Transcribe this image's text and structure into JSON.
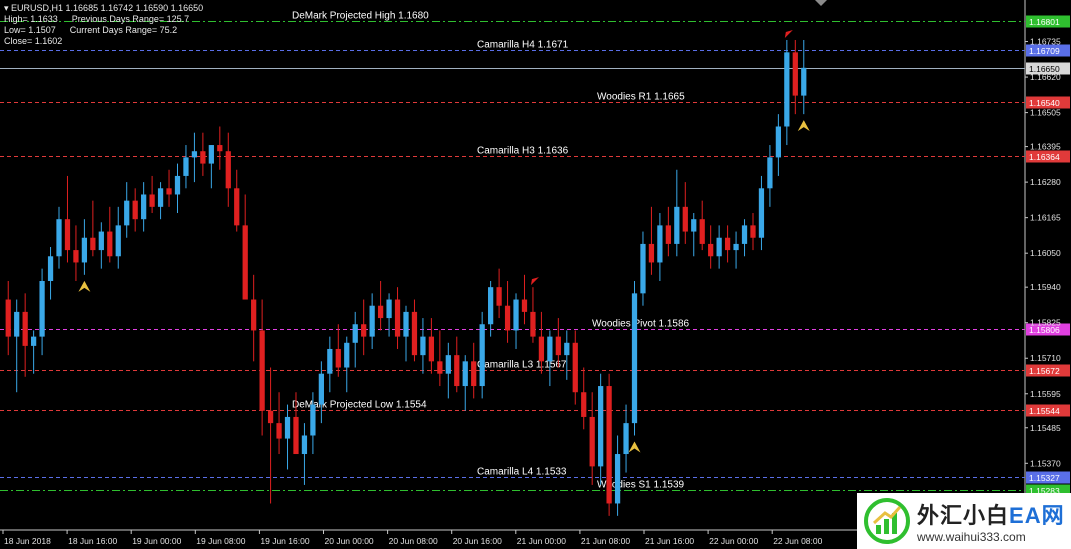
{
  "header": {
    "symbol_line": "EURUSD,H1  1.16685 1.16742 1.16590 1.16650",
    "high": "High= 1.1633",
    "low": "Low= 1.1507",
    "close": "Close= 1.1602",
    "prev_range": "Previous Days Range= 125.7",
    "curr_range": "Current Days Range= 75.2"
  },
  "colors": {
    "bull": "#3aa8e8",
    "bear": "#e02020",
    "green_level": "#2fbf2f",
    "blue_level": "#5a6fe8",
    "red_level": "#e03a3a",
    "magenta_level": "#e040e0",
    "current_price_line": "#a0b0c0",
    "arrow": "#e8c040"
  },
  "levels": [
    {
      "label": "DeMark Projected High 1.1680",
      "price": 1.16801,
      "tag": "1.16801",
      "color": "#2fbf2f",
      "style": "dashdot"
    },
    {
      "label": "Camarilla H4 1.1671",
      "price": 1.16709,
      "tag": "1.16709",
      "color": "#5a6fe8",
      "style": "dashed"
    },
    {
      "label": "",
      "price": 1.1665,
      "tag": "1.16650",
      "color": "#a0b0c0",
      "style": "solid",
      "current": true
    },
    {
      "label": "Woodies R1 1.1665",
      "price": 1.1654,
      "tag": "1.16540",
      "color": "#e03a3a",
      "style": "dashed"
    },
    {
      "label": "Camarilla H3 1.1636",
      "price": 1.16364,
      "tag": "1.16364",
      "color": "#e03a3a",
      "style": "dashed"
    },
    {
      "label": "Woodies Pivot 1.1586",
      "price": 1.15806,
      "tag": "1.15806",
      "color": "#e040e0",
      "style": "dashed"
    },
    {
      "label": "Camarilla L3 1.1567",
      "price": 1.15672,
      "tag": "1.15672",
      "color": "#e03a3a",
      "style": "dashed"
    },
    {
      "label": "DeMark Projected Low 1.1554",
      "price": 1.15544,
      "tag": "1.15544",
      "color": "#e03a3a",
      "style": "dashed"
    },
    {
      "label": "Camarilla L4 1.1533",
      "price": 1.15327,
      "tag": "1.15327",
      "color": "#5a6fe8",
      "style": "dashed"
    },
    {
      "label": "Woodies S1 1.1539",
      "price": 1.15283,
      "tag": "1.15283",
      "color": "#2fbf2f",
      "style": "dashdot"
    }
  ],
  "price_ticks": [
    "1.16735",
    "1.16620",
    "1.16505",
    "1.16395",
    "1.16280",
    "1.16165",
    "1.16050",
    "1.15940",
    "1.15825",
    "1.15710",
    "1.15595",
    "1.15485",
    "1.15370",
    "1.15255"
  ],
  "price_tick_values": [
    1.16735,
    1.1662,
    1.16505,
    1.16395,
    1.1628,
    1.16165,
    1.1605,
    1.1594,
    1.15825,
    1.1571,
    1.15595,
    1.15485,
    1.1537,
    1.15255
  ],
  "time_ticks": [
    "18 Jun 2018",
    "18 Jun 16:00",
    "19 Jun 00:00",
    "19 Jun 08:00",
    "19 Jun 16:00",
    "20 Jun 00:00",
    "20 Jun 08:00",
    "20 Jun 16:00",
    "21 Jun 00:00",
    "21 Jun 08:00",
    "21 Jun 16:00",
    "22 Jun 00:00",
    "22 Jun 08:00"
  ],
  "watermark": {
    "brand": "外汇小白",
    "ea": "EA网",
    "url": "www.waihui333.com"
  },
  "chart_data": {
    "type": "candlestick",
    "symbol": "EURUSD",
    "timeframe": "H1",
    "ylim": [
      1.1518,
      1.1685
    ],
    "candles": [
      [
        1.159,
        1.1596,
        1.1572,
        1.1578
      ],
      [
        1.1578,
        1.159,
        1.156,
        1.1586
      ],
      [
        1.1586,
        1.1592,
        1.1565,
        1.1575
      ],
      [
        1.1575,
        1.158,
        1.1566,
        1.1578
      ],
      [
        1.1578,
        1.16,
        1.1572,
        1.1596
      ],
      [
        1.1596,
        1.1607,
        1.159,
        1.1604
      ],
      [
        1.1604,
        1.162,
        1.16,
        1.1616
      ],
      [
        1.1616,
        1.163,
        1.1602,
        1.1606
      ],
      [
        1.1606,
        1.1614,
        1.1596,
        1.1602
      ],
      [
        1.1602,
        1.1616,
        1.1598,
        1.161
      ],
      [
        1.161,
        1.1622,
        1.1604,
        1.1606
      ],
      [
        1.1606,
        1.1615,
        1.16,
        1.1612
      ],
      [
        1.1612,
        1.162,
        1.1602,
        1.1604
      ],
      [
        1.1604,
        1.162,
        1.16,
        1.1614
      ],
      [
        1.1614,
        1.1628,
        1.161,
        1.1622
      ],
      [
        1.1622,
        1.1626,
        1.1612,
        1.1616
      ],
      [
        1.1616,
        1.1628,
        1.1612,
        1.1624
      ],
      [
        1.1624,
        1.163,
        1.1618,
        1.162
      ],
      [
        1.162,
        1.1628,
        1.1616,
        1.1626
      ],
      [
        1.1626,
        1.1632,
        1.162,
        1.1624
      ],
      [
        1.1624,
        1.1634,
        1.1618,
        1.163
      ],
      [
        1.163,
        1.164,
        1.1626,
        1.1636
      ],
      [
        1.1636,
        1.1644,
        1.1628,
        1.1638
      ],
      [
        1.1638,
        1.1644,
        1.163,
        1.1634
      ],
      [
        1.1634,
        1.164,
        1.1626,
        1.164
      ],
      [
        1.164,
        1.1646,
        1.1632,
        1.1638
      ],
      [
        1.1638,
        1.1644,
        1.162,
        1.1626
      ],
      [
        1.1626,
        1.1632,
        1.1612,
        1.1614
      ],
      [
        1.1614,
        1.1624,
        1.1594,
        1.159
      ],
      [
        1.159,
        1.1598,
        1.157,
        1.158
      ],
      [
        1.158,
        1.159,
        1.1546,
        1.1554
      ],
      [
        1.1554,
        1.1568,
        1.1524,
        1.155
      ],
      [
        1.155,
        1.156,
        1.154,
        1.1545
      ],
      [
        1.1545,
        1.1556,
        1.1535,
        1.1552
      ],
      [
        1.1552,
        1.156,
        1.154,
        1.154
      ],
      [
        1.154,
        1.155,
        1.153,
        1.1546
      ],
      [
        1.1546,
        1.156,
        1.154,
        1.1556
      ],
      [
        1.1556,
        1.157,
        1.155,
        1.1566
      ],
      [
        1.1566,
        1.1578,
        1.156,
        1.1574
      ],
      [
        1.1574,
        1.1582,
        1.1565,
        1.1568
      ],
      [
        1.1568,
        1.1578,
        1.156,
        1.1576
      ],
      [
        1.1576,
        1.1586,
        1.1568,
        1.1582
      ],
      [
        1.1582,
        1.159,
        1.1572,
        1.1578
      ],
      [
        1.1578,
        1.1592,
        1.1574,
        1.1588
      ],
      [
        1.1588,
        1.1596,
        1.158,
        1.1584
      ],
      [
        1.1584,
        1.1592,
        1.1578,
        1.159
      ],
      [
        1.159,
        1.1594,
        1.1574,
        1.1578
      ],
      [
        1.1578,
        1.1588,
        1.157,
        1.1586
      ],
      [
        1.1586,
        1.159,
        1.157,
        1.1572
      ],
      [
        1.1572,
        1.1584,
        1.1566,
        1.1578
      ],
      [
        1.1578,
        1.1584,
        1.1566,
        1.157
      ],
      [
        1.157,
        1.158,
        1.1562,
        1.1566
      ],
      [
        1.1566,
        1.1576,
        1.1558,
        1.1572
      ],
      [
        1.1572,
        1.1578,
        1.156,
        1.1562
      ],
      [
        1.1562,
        1.1572,
        1.1554,
        1.157
      ],
      [
        1.157,
        1.1576,
        1.1558,
        1.1562
      ],
      [
        1.1562,
        1.1586,
        1.1558,
        1.1582
      ],
      [
        1.1582,
        1.1596,
        1.1578,
        1.1594
      ],
      [
        1.1594,
        1.16,
        1.1584,
        1.1588
      ],
      [
        1.1588,
        1.1596,
        1.1576,
        1.158
      ],
      [
        1.158,
        1.1592,
        1.1574,
        1.159
      ],
      [
        1.159,
        1.1598,
        1.1582,
        1.1586
      ],
      [
        1.1586,
        1.1594,
        1.1576,
        1.1578
      ],
      [
        1.1578,
        1.1586,
        1.1566,
        1.157
      ],
      [
        1.157,
        1.158,
        1.1562,
        1.1578
      ],
      [
        1.1578,
        1.1584,
        1.1568,
        1.1572
      ],
      [
        1.1572,
        1.158,
        1.1564,
        1.1576
      ],
      [
        1.1576,
        1.158,
        1.1556,
        1.156
      ],
      [
        1.156,
        1.1568,
        1.1548,
        1.1552
      ],
      [
        1.1552,
        1.156,
        1.153,
        1.1536
      ],
      [
        1.1536,
        1.1566,
        1.153,
        1.1562
      ],
      [
        1.1562,
        1.1566,
        1.152,
        1.1524
      ],
      [
        1.1524,
        1.1546,
        1.152,
        1.154
      ],
      [
        1.154,
        1.1556,
        1.1534,
        1.155
      ],
      [
        1.155,
        1.1596,
        1.1546,
        1.1592
      ],
      [
        1.1592,
        1.1612,
        1.1588,
        1.1608
      ],
      [
        1.1608,
        1.162,
        1.1598,
        1.1602
      ],
      [
        1.1602,
        1.1618,
        1.1596,
        1.1614
      ],
      [
        1.1614,
        1.162,
        1.1604,
        1.1608
      ],
      [
        1.1608,
        1.1632,
        1.1604,
        1.162
      ],
      [
        1.162,
        1.1628,
        1.1608,
        1.1612
      ],
      [
        1.1612,
        1.1618,
        1.1604,
        1.1616
      ],
      [
        1.1616,
        1.1622,
        1.1606,
        1.1608
      ],
      [
        1.1608,
        1.1614,
        1.16,
        1.1604
      ],
      [
        1.1604,
        1.1614,
        1.16,
        1.161
      ],
      [
        1.161,
        1.1614,
        1.1602,
        1.1606
      ],
      [
        1.1606,
        1.1612,
        1.16,
        1.1608
      ],
      [
        1.1608,
        1.1616,
        1.1604,
        1.1614
      ],
      [
        1.1614,
        1.1618,
        1.1606,
        1.161
      ],
      [
        1.161,
        1.163,
        1.1606,
        1.1626
      ],
      [
        1.1626,
        1.164,
        1.162,
        1.1636
      ],
      [
        1.1636,
        1.165,
        1.163,
        1.1646
      ],
      [
        1.1646,
        1.1674,
        1.164,
        1.167
      ],
      [
        1.167,
        1.1674,
        1.165,
        1.1656
      ],
      [
        1.1656,
        1.1674,
        1.165,
        1.1665
      ]
    ]
  }
}
